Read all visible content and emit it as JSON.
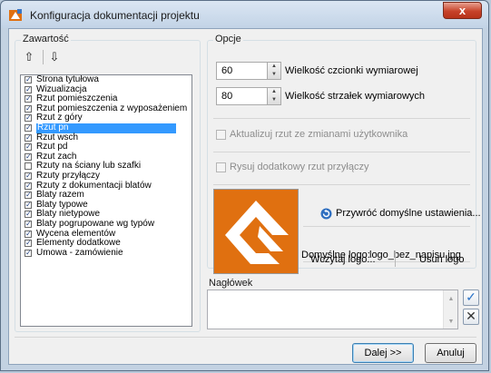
{
  "window": {
    "title": "Konfiguracja dokumentacji projektu",
    "close_glyph": "x"
  },
  "contents": {
    "label": "Zawartość",
    "up_icon": "⇧",
    "down_icon": "⇩",
    "items": [
      {
        "label": "Strona tytułowa",
        "checked": true
      },
      {
        "label": "Wizualizacja",
        "checked": true
      },
      {
        "label": "Rzut pomieszczenia",
        "checked": true
      },
      {
        "label": "Rzut pomieszczenia z wyposażeniem",
        "checked": true
      },
      {
        "label": "Rzut z góry",
        "checked": true
      },
      {
        "label": "Rzut pn",
        "checked": true,
        "selected": true
      },
      {
        "label": "Rzut wsch",
        "checked": true
      },
      {
        "label": "Rzut pd",
        "checked": true
      },
      {
        "label": "Rzut zach",
        "checked": true
      },
      {
        "label": "Rzuty na ściany lub szafki",
        "checked": false
      },
      {
        "label": "Rzuty przyłączy",
        "checked": true
      },
      {
        "label": "Rzuty z dokumentacji blatów",
        "checked": true
      },
      {
        "label": "Blaty razem",
        "checked": true
      },
      {
        "label": "Blaty typowe",
        "checked": true
      },
      {
        "label": "Blaty nietypowe",
        "checked": true
      },
      {
        "label": "Blaty pogrupowane wg typów",
        "checked": true
      },
      {
        "label": "Wycena elementów",
        "checked": true
      },
      {
        "label": "Elementy dodatkowe",
        "checked": true
      },
      {
        "label": "Umowa - zamówienie",
        "checked": true
      }
    ]
  },
  "options": {
    "label": "Opcje",
    "font_size": {
      "value": "60",
      "label": "Wielkość czcionki wymiarowej"
    },
    "arrow_size": {
      "value": "80",
      "label": "Wielkość strzałek wymiarowych"
    },
    "update_view": {
      "label": "Aktualizuj rzut ze zmianami użytkownika",
      "checked": false
    },
    "draw_connections": {
      "label": "Rysuj dodatkowy rzut przyłączy",
      "checked": false
    },
    "restore_defaults": "Przywróć domyślne ustawienia...",
    "default_logo_label": "Domyślne logo:",
    "default_logo_value": "logo_bez_napisu.jpg",
    "load_logo": "Wczytaj logo...",
    "remove_logo": "Usuń logo"
  },
  "header_group": {
    "label": "Nagłówek",
    "value": ""
  },
  "footer": {
    "next": "Dalej >>",
    "cancel": "Anuluj"
  },
  "colors": {
    "accent": "#3399ff",
    "logo": "#e07010",
    "close": "#c7432a"
  }
}
